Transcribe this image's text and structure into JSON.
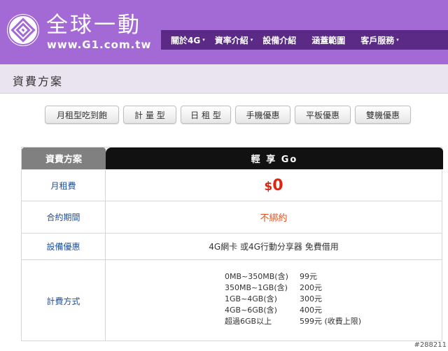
{
  "brand": {
    "name": "全球一動",
    "url": "www.G1.com.tw"
  },
  "nav": {
    "items": [
      {
        "label": "關於4G",
        "has_dropdown": true
      },
      {
        "label": "資率介紹",
        "has_dropdown": true
      },
      {
        "label": "設備介紹",
        "has_dropdown": false
      },
      {
        "label": "涵蓋範圍",
        "has_dropdown": false
      },
      {
        "label": "客戶服務",
        "has_dropdown": true
      }
    ],
    "caret": "▾"
  },
  "page": {
    "title": "資費方案"
  },
  "tabs": [
    {
      "label": "月租型吃到飽"
    },
    {
      "label": "計 量 型"
    },
    {
      "label": "日 租 型"
    },
    {
      "label": "手機優惠"
    },
    {
      "label": "平板優惠"
    },
    {
      "label": "雙機優惠"
    }
  ],
  "plan_table": {
    "header_left": "資費方案",
    "header_right": "輕 享 Go",
    "monthly_fee": {
      "label": "月租費",
      "currency": "$",
      "amount": "0"
    },
    "contract": {
      "label": "合約期間",
      "value": "不綁約"
    },
    "device": {
      "label": "設備優惠",
      "value": "4G網卡 或4G行動分享器 免費借用"
    },
    "billing": {
      "label": "計費方式",
      "tiers": [
        {
          "range": "0MB~350MB(含)",
          "price": "99元"
        },
        {
          "range": "350MB~1GB(含)",
          "price": "200元"
        },
        {
          "range": "1GB~4GB(含)",
          "price": "300元"
        },
        {
          "range": "4GB~6GB(含)",
          "price": "400元"
        },
        {
          "range": "超過6GB以上",
          "price": "599元 (收費上限)"
        }
      ]
    }
  },
  "watermark": "#288211",
  "colors": {
    "header_purple": "#a36ad6",
    "nav_purple": "#5a2a86",
    "price_red": "#e2230e",
    "label_blue": "#1d4f9c"
  }
}
